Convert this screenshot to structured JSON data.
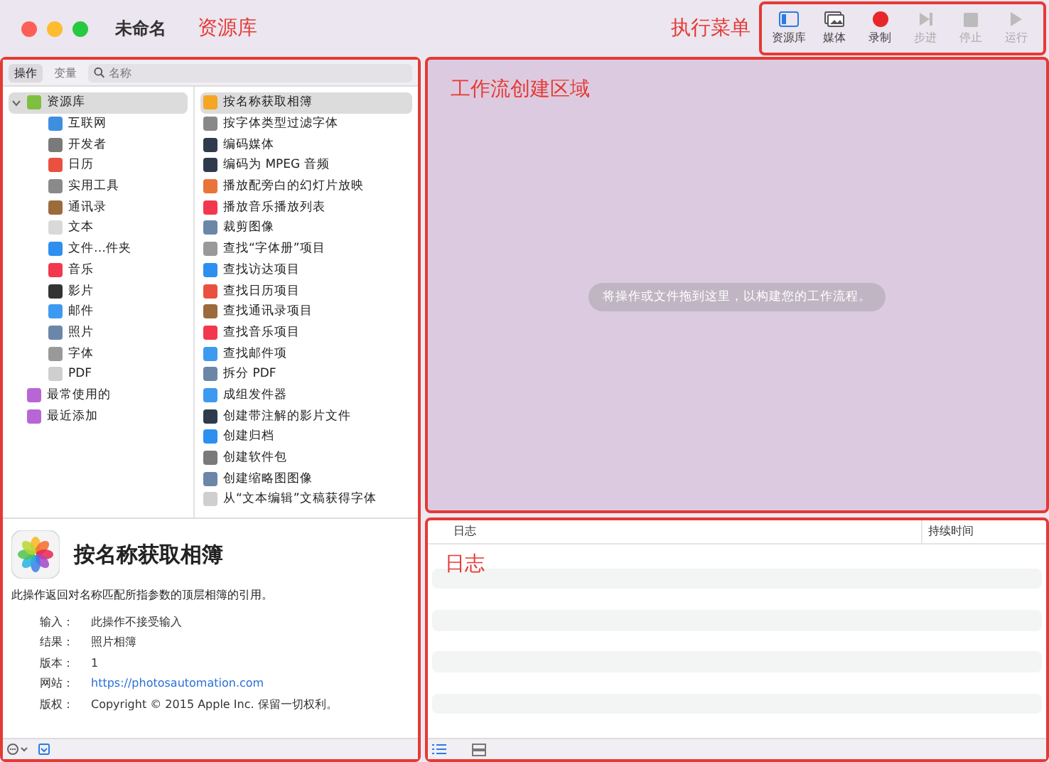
{
  "window": {
    "title": "未命名"
  },
  "toolbar": {
    "annotation": "执行菜单",
    "buttons": [
      {
        "label": "资源库",
        "kind": "library",
        "on": true,
        "disabled": false
      },
      {
        "label": "媒体",
        "kind": "media",
        "disabled": false
      },
      {
        "label": "录制",
        "kind": "record",
        "disabled": false
      },
      {
        "label": "步进",
        "kind": "step",
        "disabled": true
      },
      {
        "label": "停止",
        "kind": "stop",
        "disabled": true
      },
      {
        "label": "运行",
        "kind": "run",
        "disabled": true
      }
    ]
  },
  "library": {
    "annotation": "资源库",
    "tabs": [
      {
        "label": "操作",
        "selected": true
      },
      {
        "label": "变量",
        "selected": false
      }
    ],
    "search": {
      "placeholder": "名称"
    },
    "categories": [
      {
        "label": "资源库",
        "selected": true,
        "expanded": true,
        "children": [
          {
            "label": "互联网"
          },
          {
            "label": "开发者"
          },
          {
            "label": "日历"
          },
          {
            "label": "实用工具"
          },
          {
            "label": "通讯录"
          },
          {
            "label": "文本"
          },
          {
            "label": "文件…件夹"
          },
          {
            "label": "音乐"
          },
          {
            "label": "影片"
          },
          {
            "label": "邮件"
          },
          {
            "label": "照片"
          },
          {
            "label": "字体"
          },
          {
            "label": "PDF"
          }
        ]
      },
      {
        "label": "最常使用的",
        "selected": false
      },
      {
        "label": "最近添加",
        "selected": false
      }
    ],
    "actions": [
      {
        "label": "按名称获取相簿",
        "selected": true
      },
      {
        "label": "按字体类型过滤字体",
        "selected": false
      },
      {
        "label": "编码媒体",
        "selected": false
      },
      {
        "label": "编码为 MPEG 音频",
        "selected": false
      },
      {
        "label": "播放配旁白的幻灯片放映",
        "selected": false
      },
      {
        "label": "播放音乐播放列表",
        "selected": false
      },
      {
        "label": "裁剪图像",
        "selected": false
      },
      {
        "label": "查找“字体册”项目",
        "selected": false
      },
      {
        "label": "查找访达项目",
        "selected": false
      },
      {
        "label": "查找日历项目",
        "selected": false
      },
      {
        "label": "查找通讯录项目",
        "selected": false
      },
      {
        "label": "查找音乐项目",
        "selected": false
      },
      {
        "label": "查找邮件项",
        "selected": false
      },
      {
        "label": "拆分 PDF",
        "selected": false
      },
      {
        "label": "成组发件器",
        "selected": false
      },
      {
        "label": "创建带注解的影片文件",
        "selected": false
      },
      {
        "label": "创建归档",
        "selected": false
      },
      {
        "label": "创建软件包",
        "selected": false
      },
      {
        "label": "创建缩略图图像",
        "selected": false
      },
      {
        "label": "从“文本编辑”文稿获得字体",
        "selected": false
      }
    ],
    "detail": {
      "title": "按名称获取相簿",
      "description": "此操作返回对名称匹配所指参数的顶层相簿的引用。",
      "fields": [
        {
          "label": "输入：",
          "value": "此操作不接受输入",
          "kind": "text"
        },
        {
          "label": "结果：",
          "value": "照片相簿",
          "kind": "text"
        },
        {
          "label": "版本：",
          "value": "1",
          "kind": "text"
        },
        {
          "label": "网站：",
          "value": "https://photosautomation.com",
          "kind": "link"
        },
        {
          "label": "版权：",
          "value": "Copyright © 2015 Apple Inc. 保留一切权利。",
          "kind": "text"
        }
      ]
    }
  },
  "workflow": {
    "annotation": "工作流创建区域",
    "hint": "将操作或文件拖到这里，以构建您的工作流程。"
  },
  "log": {
    "annotation": "日志",
    "columns": [
      "日志",
      "持续时间"
    ]
  }
}
